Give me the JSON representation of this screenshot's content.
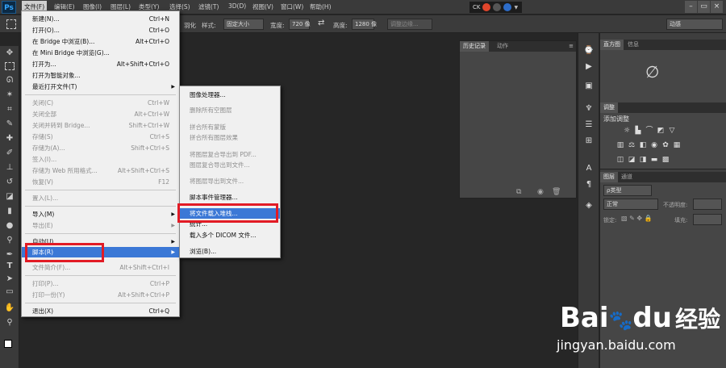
{
  "app": {
    "logo": "Ps"
  },
  "menubar": {
    "items": [
      "文件(F)",
      "编辑(E)",
      "图像(I)",
      "图层(L)",
      "类型(Y)",
      "选择(S)",
      "滤镜(T)",
      "3D(D)",
      "视图(V)",
      "窗口(W)",
      "帮助(H)"
    ],
    "tray_text": "CK",
    "window_buttons": [
      "–",
      "▭",
      "×"
    ]
  },
  "optionsbar": {
    "feather_partial": "羽化",
    "style_label": "样式:",
    "style_value": "固定大小",
    "width_label": "宽度:",
    "width_value": "720 像",
    "height_label": "高度:",
    "height_value": "1280 像",
    "refine_edge": "调整边缘...",
    "workspace": "动感"
  },
  "file_menu": {
    "items": [
      {
        "label": "新建(N)...",
        "shortcut": "Ctrl+N",
        "disabled": false
      },
      {
        "label": "打开(O)...",
        "shortcut": "Ctrl+O",
        "disabled": false
      },
      {
        "label": "在 Bridge 中浏览(B)...",
        "shortcut": "Alt+Ctrl+O",
        "disabled": false
      },
      {
        "label": "在 Mini Bridge 中浏览(G)...",
        "shortcut": "",
        "disabled": false
      },
      {
        "label": "打开为...",
        "shortcut": "Alt+Shift+Ctrl+O",
        "disabled": false
      },
      {
        "label": "打开为智能对象...",
        "shortcut": "",
        "disabled": false
      },
      {
        "label": "最近打开文件(T)",
        "shortcut": "",
        "disabled": false,
        "submenu": true
      },
      {
        "label": "关闭(C)",
        "shortcut": "Ctrl+W",
        "disabled": true
      },
      {
        "label": "关闭全部",
        "shortcut": "Alt+Ctrl+W",
        "disabled": true
      },
      {
        "label": "关闭并转到 Bridge...",
        "shortcut": "Shift+Ctrl+W",
        "disabled": true
      },
      {
        "label": "存储(S)",
        "shortcut": "Ctrl+S",
        "disabled": true
      },
      {
        "label": "存储为(A)...",
        "shortcut": "Shift+Ctrl+S",
        "disabled": true
      },
      {
        "label": "签入(I)...",
        "shortcut": "",
        "disabled": true
      },
      {
        "label": "存储为 Web 所用格式...",
        "shortcut": "Alt+Shift+Ctrl+S",
        "disabled": true
      },
      {
        "label": "恢复(V)",
        "shortcut": "F12",
        "disabled": true
      },
      {
        "label": "置入(L)...",
        "shortcut": "",
        "disabled": true
      },
      {
        "label": "导入(M)",
        "shortcut": "",
        "disabled": false,
        "submenu": true
      },
      {
        "label": "导出(E)",
        "shortcut": "",
        "disabled": true,
        "submenu": true
      },
      {
        "label": "自动(U)",
        "shortcut": "",
        "disabled": false,
        "submenu": true
      },
      {
        "label": "脚本(R)",
        "shortcut": "",
        "disabled": false,
        "submenu": true,
        "highlighted": true
      },
      {
        "label": "文件简介(F)...",
        "shortcut": "Alt+Shift+Ctrl+I",
        "disabled": true
      },
      {
        "label": "打印(P)...",
        "shortcut": "Ctrl+P",
        "disabled": true
      },
      {
        "label": "打印一份(Y)",
        "shortcut": "Alt+Shift+Ctrl+P",
        "disabled": true
      },
      {
        "label": "退出(X)",
        "shortcut": "Ctrl+Q",
        "disabled": false
      }
    ]
  },
  "script_menu": {
    "items": [
      {
        "label": "图像处理器...",
        "disabled": false
      },
      {
        "label": "删除所有空图层",
        "disabled": true
      },
      {
        "label": "拼合所有蒙版",
        "disabled": true
      },
      {
        "label": "拼合所有图层效果",
        "disabled": true
      },
      {
        "label": "将图层复合导出到 PDF...",
        "disabled": true
      },
      {
        "label": "图层复合导出到文件...",
        "disabled": true
      },
      {
        "label": "将图层导出到文件...",
        "disabled": true
      },
      {
        "label": "脚本事件管理器...",
        "disabled": false
      },
      {
        "label": "将文件载入堆栈...",
        "disabled": false,
        "highlighted": true
      },
      {
        "label": "统计...",
        "disabled": false
      },
      {
        "label": "载入多个 DICOM 文件...",
        "disabled": false
      },
      {
        "label": "浏览(B)...",
        "disabled": false
      }
    ]
  },
  "history_panel": {
    "tabs": [
      "历史记录",
      "动作"
    ]
  },
  "right_panels": {
    "histogram_tabs": [
      "直方图",
      "信息"
    ],
    "adjust_tab": "调整",
    "adjust_title": "添加调整",
    "layers_tabs": [
      "图层",
      "通道"
    ],
    "kind_label": "ρ类型",
    "blend_mode": "正常",
    "opacity_label": "不透明度:",
    "lock_label": "锁定:",
    "fill_label": "填充:"
  },
  "watermark": {
    "brand_a": "Bai",
    "brand_b": "du",
    "brand_cn": "经验",
    "url": "jingyan.baidu.com"
  }
}
